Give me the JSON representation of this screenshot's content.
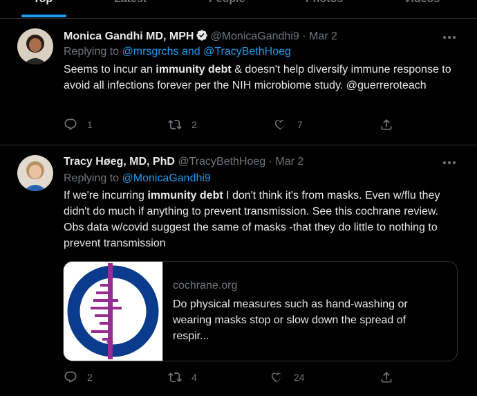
{
  "tabs": [
    {
      "label": "Top"
    },
    {
      "label": "Latest"
    },
    {
      "label": "People"
    },
    {
      "label": "Photos"
    },
    {
      "label": "Videos"
    }
  ],
  "tweet1": {
    "name": "Monica Gandhi MD, MPH",
    "handle": "@MonicaGandhi9",
    "sep": "·",
    "date": "Mar 2",
    "replying_prefix": "Replying to",
    "replying_to": "@mrsgrchs and @TracyBethHoeg",
    "body_1": "Seems to incur an ",
    "body_bold": "immunity debt",
    "body_2": " & doesn't help diversify immune response to avoid all infections forever per the NIH microbiome study. @guerreroteach",
    "replies": "1",
    "retweets": "2",
    "likes": "7"
  },
  "tweet2": {
    "name": "Tracy Høeg, MD, PhD",
    "handle": "@TracyBethHoeg",
    "sep": "·",
    "date": "Mar 2",
    "replying_prefix": "Replying to",
    "replying_to": "@MonicaGandhi9",
    "body_1": "If we're incurring ",
    "body_bold": "immunity debt",
    "body_2": " I don't think it's from masks. Even w/flu they didn't do much if anything to prevent transmission. See this cochrane review. Obs data w/covid suggest the same of masks -that they do little to nothing to prevent transmission",
    "card_domain": "cochrane.org",
    "card_title": "Do physical measures such as hand-washing or wearing masks stop or slow down the spread of respir...",
    "replies": "2",
    "retweets": "4",
    "likes": "24"
  },
  "icons": {
    "verified": "verified-badge-icon",
    "more": "more-options-icon",
    "reply": "reply-icon",
    "retweet": "retweet-icon",
    "like": "heart-icon",
    "share": "share-icon"
  },
  "colors": {
    "background": "#000000",
    "accent": "#1d9bf0",
    "muted": "#71767b",
    "text": "#e7e9ea",
    "cochrane_blue": "#0b3b8c",
    "cochrane_purple": "#962d91"
  }
}
